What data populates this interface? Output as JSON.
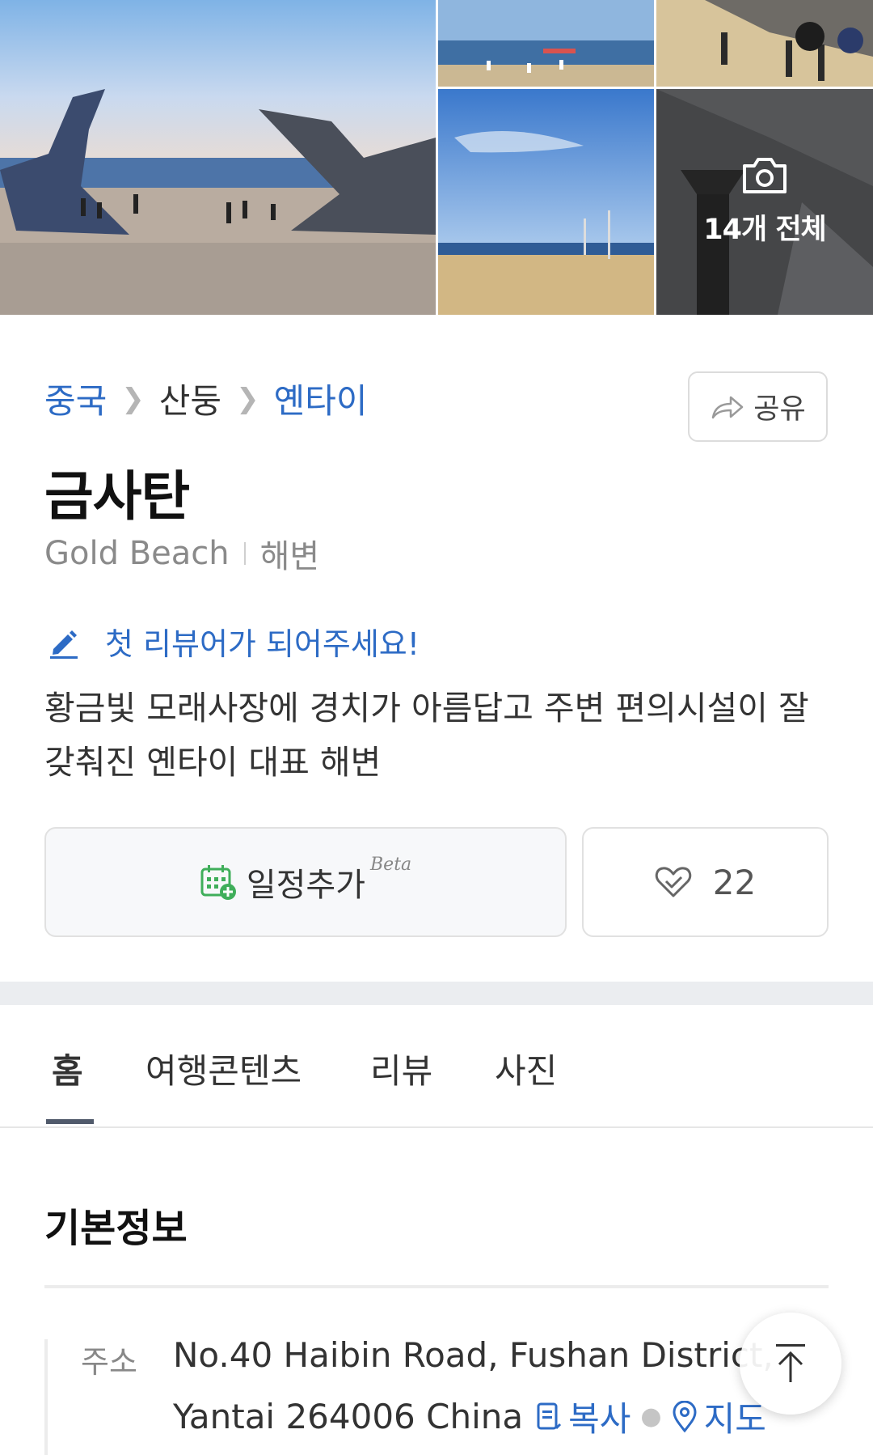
{
  "gallery": {
    "more_label": "14개 전체",
    "photo_names": [
      "whale-tail-sculpture-photo",
      "beach-crowd-photo",
      "beach-umbrella-people-photo",
      "beach-sky-photo",
      "more-photos-tile"
    ]
  },
  "breadcrumb": {
    "items": [
      "중국",
      "산둥",
      "옌타이"
    ]
  },
  "share": {
    "label": "공유",
    "icon": "share-arrow-icon"
  },
  "place": {
    "title": "금사탄",
    "english_name": "Gold Beach",
    "category": "해변"
  },
  "review_cta": {
    "label": "첫 리뷰어가 되어주세요!",
    "icon": "pencil-icon"
  },
  "description": "황금빛 모래사장에 경치가 아름답고 주변 편의시설이 잘 갖춰진 옌타이 대표 해변",
  "actions": {
    "schedule_label": "일정추가",
    "schedule_badge": "Beta",
    "like_count": "22"
  },
  "tabs": [
    {
      "label": "홈",
      "active": true
    },
    {
      "label": "여행콘텐츠",
      "active": false
    },
    {
      "label": "리뷰",
      "active": false
    },
    {
      "label": "사진",
      "active": false
    }
  ],
  "basic_info": {
    "title": "기본정보",
    "address_label": "주소",
    "address_line1": "No.40 Haibin Road, Fushan District,",
    "address_line2": "Yantai 264006 China",
    "copy_label": "복사",
    "map_label": "지도"
  },
  "colors": {
    "accent_blue": "#2d6bc5",
    "green_icon": "#3fae5a",
    "tab_underline": "#505a6b"
  }
}
